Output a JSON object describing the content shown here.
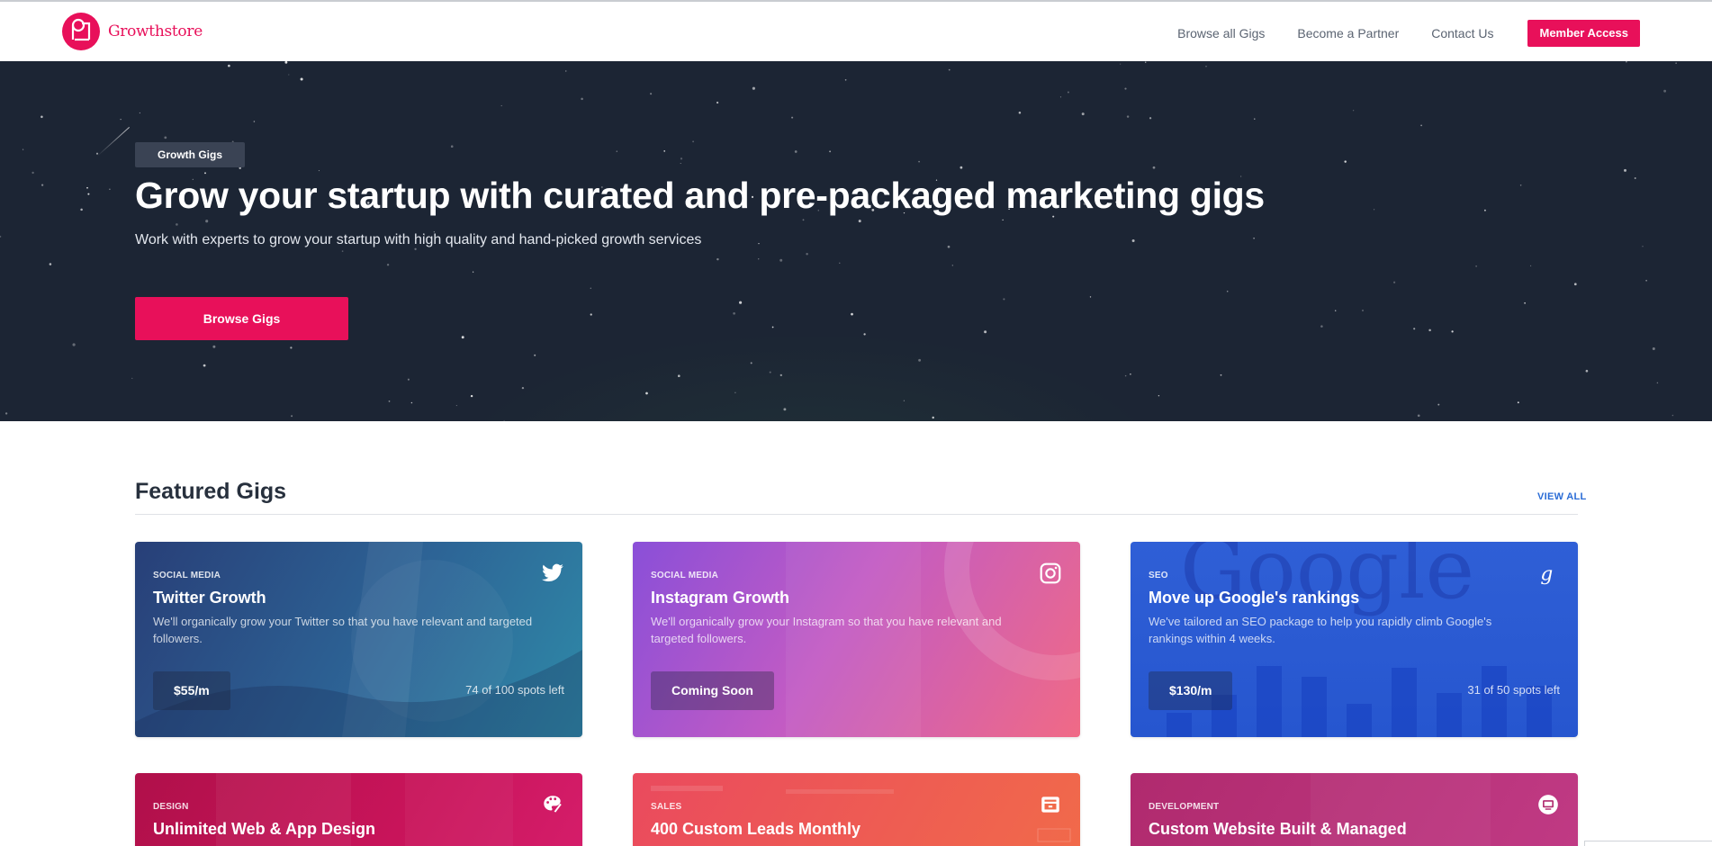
{
  "header": {
    "brand": "Growthstore",
    "nav": [
      {
        "label": "Browse all Gigs"
      },
      {
        "label": "Become a Partner"
      },
      {
        "label": "Contact Us"
      }
    ],
    "cta": "Member Access"
  },
  "hero": {
    "tag": "Growth Gigs",
    "title": "Grow your startup with curated and pre-packaged marketing gigs",
    "subtitle": "Work with experts to grow your startup with high quality and hand-picked growth services",
    "button": "Browse Gigs"
  },
  "featured": {
    "title": "Featured Gigs",
    "view_all": "VIEW ALL",
    "cards": [
      {
        "category": "SOCIAL MEDIA",
        "title": "Twitter Growth",
        "description": "We'll organically grow your Twitter so that you have relevant and targeted followers.",
        "price": "$55/m",
        "spots": "74 of 100 spots left",
        "icon": "twitter-icon"
      },
      {
        "category": "SOCIAL MEDIA",
        "title": "Instagram Growth",
        "description": "We'll organically grow your Instagram so that you have relevant and targeted followers.",
        "price": "Coming Soon",
        "spots": "",
        "icon": "instagram-icon"
      },
      {
        "category": "SEO",
        "title": "Move up Google's rankings",
        "description": "We've tailored an SEO package to help you rapidly climb Google's rankings within 4 weeks.",
        "price": "$130/m",
        "spots": "31 of 50 spots left",
        "icon": "google-icon",
        "watermark": "Google"
      },
      {
        "category": "DESIGN",
        "title": "Unlimited Web & App Design",
        "icon": "palette-icon"
      },
      {
        "category": "SALES",
        "title": "400 Custom Leads Monthly",
        "icon": "inbox-icon"
      },
      {
        "category": "DEVELOPMENT",
        "title": "Custom Website Built & Managed",
        "icon": "monitor-icon"
      }
    ]
  },
  "colors": {
    "brand": "#e8105a",
    "hero_bg": "#1c2534",
    "link": "#2a6cd6"
  }
}
